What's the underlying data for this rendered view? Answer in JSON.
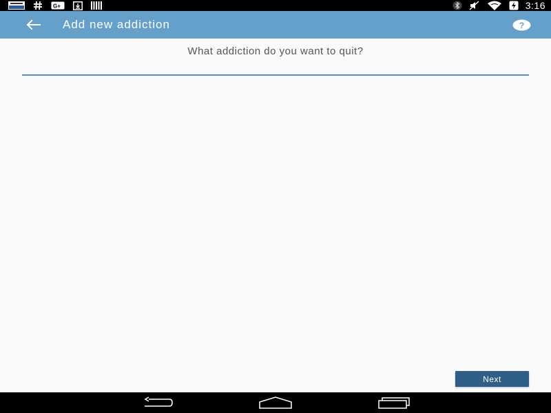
{
  "status_bar": {
    "time": "3:16",
    "left_icons": [
      "wordpress-news-icon",
      "hash-icon",
      "google-plus-icon",
      "download-icon",
      "barcode-icon"
    ],
    "right_icons": [
      "bluetooth-icon",
      "mute-icon",
      "wifi-icon",
      "battery-charging-icon"
    ]
  },
  "app_bar": {
    "title": "Add new addiction",
    "background": "#64a0c9"
  },
  "form": {
    "question": "What addiction do you want to quit?",
    "input_value": "",
    "input_placeholder": "",
    "underline_color": "#5a8fb6"
  },
  "actions": {
    "next_label": "Next",
    "next_color": "#2f5f86"
  },
  "nav_bar": {
    "buttons": [
      "back-nav-icon",
      "home-nav-icon",
      "recents-nav-icon"
    ]
  }
}
